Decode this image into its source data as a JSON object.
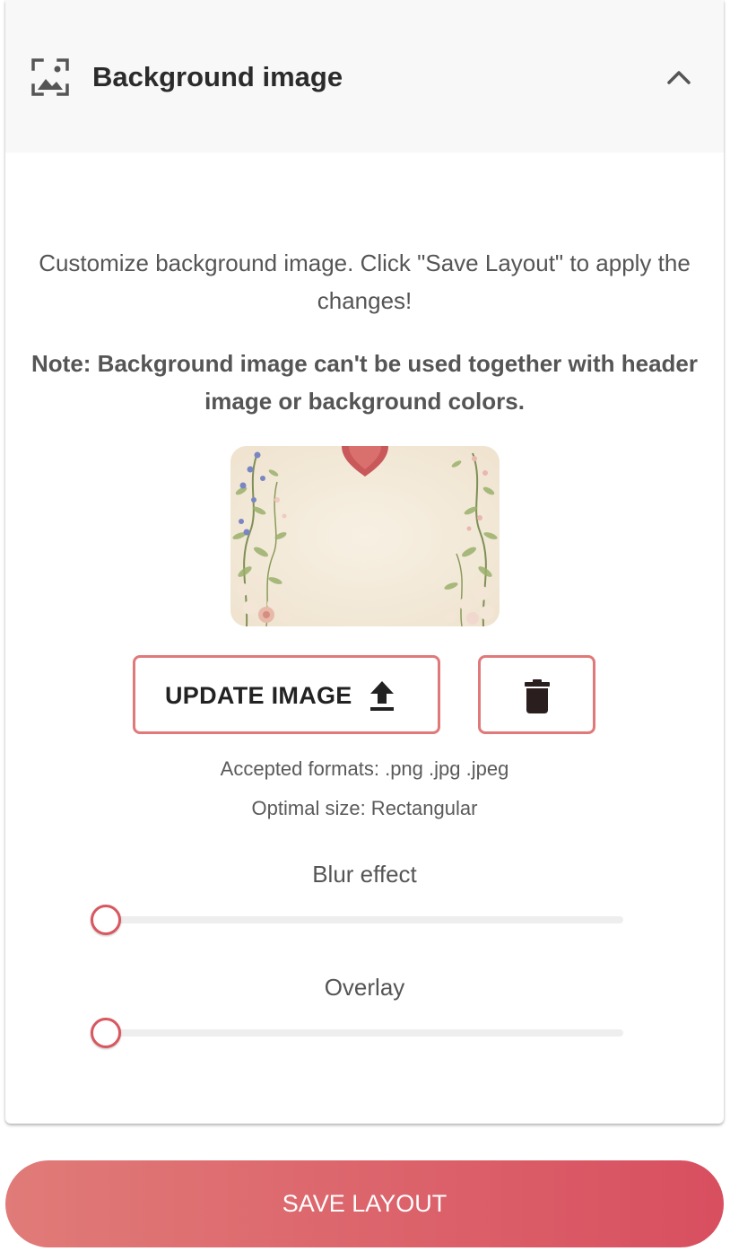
{
  "section": {
    "title": "Background image",
    "header_icon": "image-placeholder-icon",
    "toggle_icon": "chevron-up-icon",
    "expanded": true
  },
  "content": {
    "description": "Customize background image. Click \"Save Layout\" to apply the changes!",
    "note": "Note: Background image can't be used together with header image or background colors.",
    "preview_alt": "floral-background-preview"
  },
  "actions": {
    "update_label": "UPDATE IMAGE",
    "update_icon": "upload-icon",
    "delete_icon": "trash-icon"
  },
  "info": {
    "formats": "Accepted formats: .png .jpg .jpeg",
    "size": "Optimal size: Rectangular"
  },
  "sliders": {
    "blur": {
      "label": "Blur effect",
      "value": 0
    },
    "overlay": {
      "label": "Overlay",
      "value": 0
    }
  },
  "footer": {
    "save_label": "SAVE LAYOUT"
  },
  "colors": {
    "accent": "#e07a7a",
    "thumb": "#d9575f",
    "gradient_start": "#e07b78",
    "gradient_end": "#d84f60",
    "header_bg": "#f8f8f8"
  }
}
